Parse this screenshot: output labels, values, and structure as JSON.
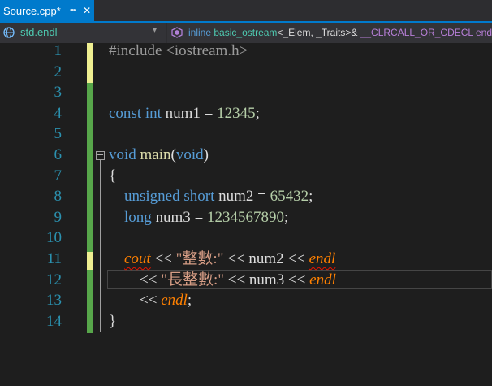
{
  "tab": {
    "title": "Source.cpp*",
    "pin_icon": "pin-icon",
    "close_icon": "close-icon"
  },
  "navbar": {
    "scope": "std.endl",
    "member_prefix_kw": "inline",
    "member_type": "basic_ostream",
    "member_template": "<_Elem, _Traits>& ",
    "member_call": "__CLRCALL_OR_CDECL endl("
  },
  "line_numbers": [
    "1",
    "2",
    "3",
    "4",
    "5",
    "6",
    "7",
    "8",
    "9",
    "10",
    "11",
    "12",
    "13",
    "14"
  ],
  "code": {
    "l1": {
      "directive": "#include <iostream.h>"
    },
    "l4": {
      "kw": "const int",
      "name": "num1",
      "eq": " = ",
      "val": "12345",
      "end": ";"
    },
    "l6": {
      "kw": "void",
      "fn": "main",
      "open": "(",
      "param": "void",
      "close": ")"
    },
    "l7": {
      "text": "{"
    },
    "l8": {
      "kw": "unsigned short",
      "name": "num2",
      "eq": " = ",
      "val": "65432",
      "end": ";"
    },
    "l9": {
      "kw": "long",
      "name": "num3",
      "eq": " = ",
      "val": "1234567890",
      "end": ";"
    },
    "l11": {
      "cout": "cout",
      "op1": " << ",
      "str": "\"整數:\"",
      "op2": " << ",
      "var": "num2",
      "op3": " << ",
      "endl": "endl"
    },
    "l12": {
      "op1": "<< ",
      "str": "\"長整數:\"",
      "op2": " << ",
      "var": "num3",
      "op3": " << ",
      "endl": "endl"
    },
    "l13": {
      "op1": "<< ",
      "endl": "endl",
      "end": ";"
    },
    "l14": {
      "text": "}"
    }
  },
  "colors": {
    "accent": "#007acc",
    "unsaved_marker": "#efef91",
    "saved_marker": "#57a64a",
    "line_number": "#2b91af"
  }
}
